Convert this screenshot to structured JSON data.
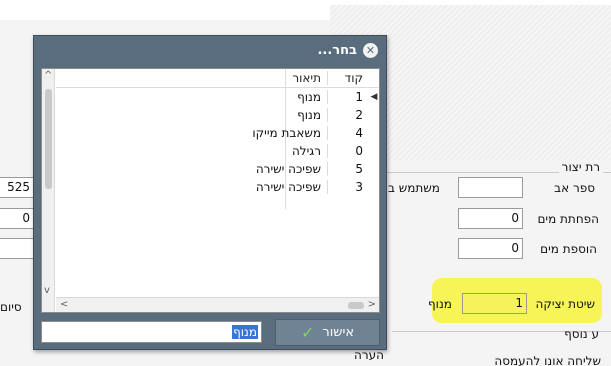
{
  "form": {
    "group_title": "רת יצור",
    "father_number_label": "ספר אב",
    "water_reduction_label": "הפחתת מים",
    "water_reduction_value": "0",
    "water_addition_label": "הוספת מים",
    "water_addition_value": "0",
    "user_label_partial": "משתמש ב",
    "left_value_1": "525",
    "left_value_2": "0",
    "casting_method_label": "שיטת יציקה",
    "casting_method_code": "1",
    "casting_method_name": "מנוף",
    "end_label_partial": "סיום",
    "additional_partial": "ע נוסף",
    "notes_label": "הערה",
    "bottom_partial": "שליחה אונו להעמסה"
  },
  "dialog": {
    "title": "בחר...",
    "columns": {
      "code": "קוד",
      "description": "תיאור"
    },
    "rows": [
      {
        "code": "1",
        "description": "מנוף"
      },
      {
        "code": "2",
        "description": "מנוף"
      },
      {
        "code": "4",
        "description": "משאבת מייקו"
      },
      {
        "code": "0",
        "description": "רגילה"
      },
      {
        "code": "5",
        "description": "שפיכה ישירה"
      },
      {
        "code": "3",
        "description": "שפיכה ישירה"
      }
    ],
    "ok_label": "אישור",
    "filter_value": "מנוף",
    "accent_color": "#5a6d7e",
    "highlight_color": "#f6f34a"
  }
}
